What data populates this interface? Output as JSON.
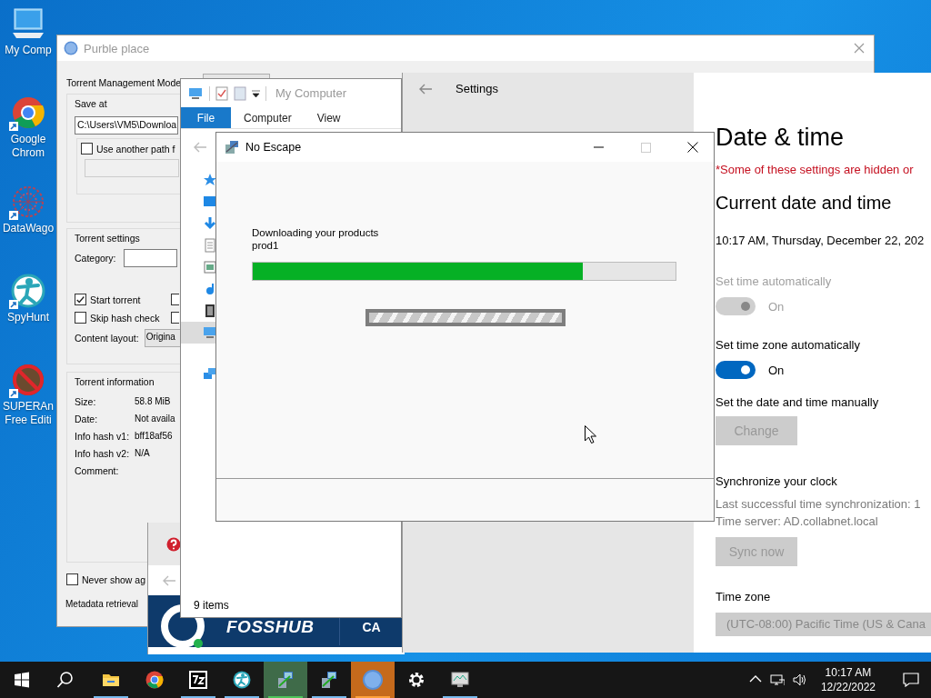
{
  "desktop_icons": [
    {
      "kind": "computer",
      "label": "My Comp"
    },
    {
      "kind": "chrome",
      "label": "Google Chrom"
    },
    {
      "kind": "mesh",
      "label": "DataWago"
    },
    {
      "kind": "figure",
      "label": "SpyHunt"
    },
    {
      "kind": "prohibited",
      "label": "SUPERAn Free Editi"
    }
  ],
  "qb": {
    "title": "Purble place",
    "management_mode_label": "Torrent Management Mode",
    "save_at": {
      "title": "Save at",
      "path": "C:\\Users\\VM5\\Downloa",
      "use_another_path": {
        "label": "Use another path f",
        "checked": false
      }
    },
    "torrent_settings": {
      "title": "Torrent settings",
      "category_label": "Category:",
      "options": [
        {
          "label": "Start torrent",
          "checked": true
        },
        {
          "label": "Skip hash check",
          "checked": false
        }
      ],
      "column_2_checkboxes": [
        {
          "checked": false
        },
        {
          "checked": false
        }
      ],
      "content_layout_label": "Content layout:",
      "content_layout_value": "Origina"
    },
    "torrent_information": {
      "title": "Torrent information",
      "rows": [
        {
          "label": "Size:",
          "value": "58.8 MiB"
        },
        {
          "label": "Date:",
          "value": "Not availa"
        },
        {
          "label": "Info hash v1:",
          "value": "bff18af56"
        },
        {
          "label": "Info hash v2:",
          "value": "N/A"
        },
        {
          "label": "Comment:"
        }
      ]
    },
    "never_show": {
      "label": "Never show ag",
      "checked": false
    },
    "metadata_label": "Metadata retrieval"
  },
  "explorer": {
    "title": "My Computer",
    "ribbon_tabs": [
      {
        "label": "File",
        "selected": true
      },
      {
        "label": "Computer",
        "selected": false
      },
      {
        "label": "View",
        "selected": false
      }
    ],
    "nav_items": [
      {
        "kind": "star",
        "selected": false
      },
      {
        "kind": "desktop",
        "selected": false
      },
      {
        "kind": "download",
        "selected": false
      },
      {
        "kind": "document",
        "selected": false
      },
      {
        "kind": "picture",
        "selected": false
      },
      {
        "kind": "music",
        "selected": false
      },
      {
        "kind": "video",
        "selected": false
      },
      {
        "kind": "computer",
        "selected": true
      },
      {
        "kind": "network",
        "selected": false
      }
    ],
    "status": "9 items"
  },
  "settings": {
    "header": "Settings",
    "title": "Date & time",
    "warning": "*Some of these settings are hidden or",
    "section_title": "Current date and time",
    "current_datetime": "10:17 AM, Thursday, December 22, 202",
    "items": [
      {
        "kind": "toggle",
        "label": "Set time automatically",
        "on": true,
        "disabled": true,
        "state_label": "On"
      },
      {
        "kind": "toggle",
        "label": "Set time zone automatically",
        "on": true,
        "disabled": false,
        "state_label": "On"
      },
      {
        "kind": "button",
        "label": "Set the date and time manually",
        "button": "Change",
        "disabled": true
      }
    ],
    "sync": {
      "title": "Synchronize your clock",
      "last_sync": "Last successful time synchronization: 1",
      "server": "Time server: AD.collabnet.local",
      "button": "Sync now",
      "disabled": true
    },
    "time_zone": {
      "label": "Time zone",
      "value": "(UTC-08:00) Pacific Time (US & Cana",
      "disabled": true
    }
  },
  "browser": {
    "logo": "FOSSHUB",
    "nav_item": "CA"
  },
  "escape": {
    "title": "No Escape",
    "message": "Downloading your products",
    "item": "prod1",
    "progress": {
      "level": 0.78
    },
    "marquee": {
      "indeterminate": true
    }
  },
  "taskbar": {
    "apps": [
      {
        "kind": "start",
        "running": false,
        "active": false,
        "flashing": false
      },
      {
        "kind": "search",
        "running": false,
        "active": false,
        "flashing": false
      },
      {
        "kind": "folder",
        "running": true,
        "active": false,
        "flashing": false
      },
      {
        "kind": "chrome",
        "running": false,
        "active": false,
        "flashing": false
      },
      {
        "kind": "archive",
        "running": true,
        "active": false,
        "flashing": false
      },
      {
        "kind": "figure",
        "running": true,
        "active": false,
        "flashing": false
      },
      {
        "kind": "setup",
        "running": true,
        "active": true,
        "flashing": false
      },
      {
        "kind": "setup",
        "running": true,
        "active": false,
        "flashing": false
      },
      {
        "kind": "torrent",
        "running": true,
        "active": false,
        "flashing": true
      },
      {
        "kind": "gear",
        "running": false,
        "active": false,
        "flashing": false
      },
      {
        "kind": "monitor",
        "running": true,
        "active": false,
        "flashing": false
      }
    ],
    "tray": [
      {
        "kind": "chevron"
      },
      {
        "kind": "network"
      },
      {
        "kind": "volume"
      }
    ],
    "clock": {
      "time": "10:17 AM",
      "date": "12/22/2022"
    }
  }
}
